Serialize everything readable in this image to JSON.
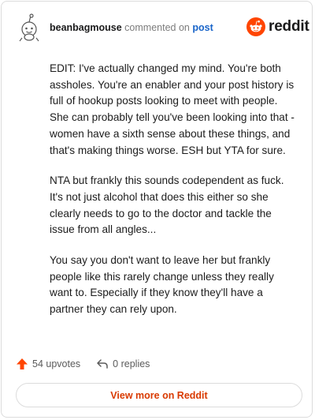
{
  "comment": {
    "author": "beanbagmouse",
    "action_text": "commented on",
    "post_link": "post",
    "paragraphs": [
      "EDIT: I've actually changed my mind. You're both assholes. You're an enabler and your post history is full of hookup posts looking to meet with people. She can probably tell you've been looking into that - women have a sixth sense about these things, and that's making things worse. ESH but YTA for sure.",
      "NTA but frankly this sounds codependent as fuck. It's not just alcohol that does this either so she clearly needs to go to the doctor and tackle the issue from all angles...",
      "You say you don't want to leave her but frankly people like this rarely change unless they really want to. Especially if they know they'll have a partner they can rely upon."
    ],
    "upvotes_label": "54 upvotes",
    "replies_label": "0 replies"
  },
  "brand": {
    "name": "reddit",
    "icon": "reddit-logo-icon",
    "color": "#ff4500"
  },
  "footer": {
    "view_more_label": "View more on Reddit"
  },
  "colors": {
    "accent": "#ff4500",
    "link": "#1a65c9",
    "view_more_text": "#d93a00",
    "border": "#dcdcdc"
  }
}
